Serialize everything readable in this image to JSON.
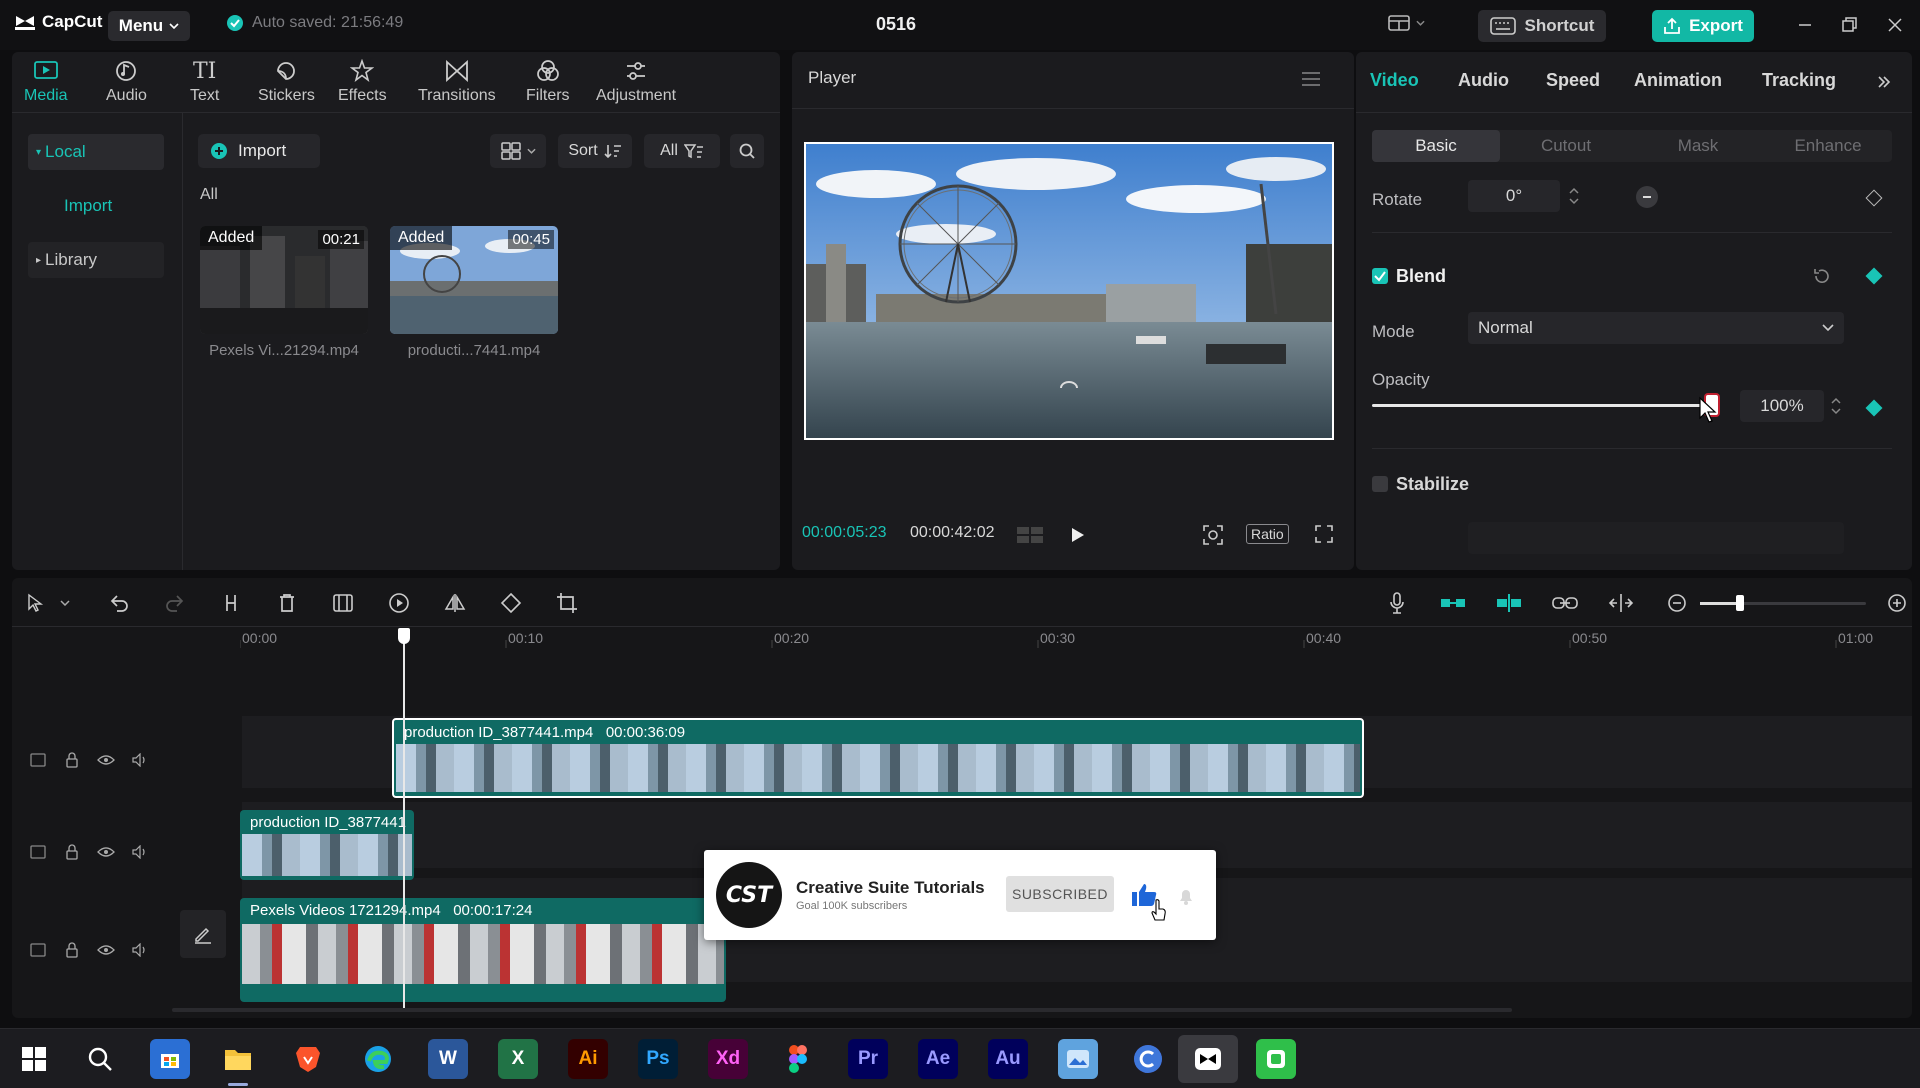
{
  "app": {
    "name": "CapCut",
    "menu_label": "Menu",
    "autosave": "Auto saved: 21:56:49",
    "project_title": "0516",
    "shortcut_label": "Shortcut",
    "export_label": "Export"
  },
  "media_panel": {
    "tabs": [
      {
        "label": "Media",
        "icon": "media-icon",
        "active": true
      },
      {
        "label": "Audio",
        "icon": "audio-icon"
      },
      {
        "label": "Text",
        "icon": "text-icon"
      },
      {
        "label": "Stickers",
        "icon": "stickers-icon"
      },
      {
        "label": "Effects",
        "icon": "effects-icon"
      },
      {
        "label": "Transitions",
        "icon": "transitions-icon"
      },
      {
        "label": "Filters",
        "icon": "filters-icon"
      },
      {
        "label": "Adjustment",
        "icon": "adjustment-icon"
      }
    ],
    "sidebar": {
      "local": "Local",
      "import": "Import",
      "library": "Library"
    },
    "import_label": "Import",
    "sort_label": "Sort",
    "filter_label": "All",
    "section_label": "All",
    "items": [
      {
        "badge": "Added",
        "duration": "00:21",
        "name": "Pexels Vi...21294.mp4"
      },
      {
        "badge": "Added",
        "duration": "00:45",
        "name": "producti...7441.mp4"
      }
    ]
  },
  "player": {
    "title": "Player",
    "current_time": "00:00:05:23",
    "total_time": "00:00:42:02",
    "ratio_label": "Ratio"
  },
  "properties": {
    "tabs": [
      "Video",
      "Audio",
      "Speed",
      "Animation",
      "Tracking"
    ],
    "active_tab": "Video",
    "subtabs": [
      "Basic",
      "Cutout",
      "Mask",
      "Enhance"
    ],
    "active_subtab": "Basic",
    "rotate_label": "Rotate",
    "rotate_value": "0°",
    "blend_label": "Blend",
    "blend_enabled": true,
    "mode_label": "Mode",
    "mode_value": "Normal",
    "opacity_label": "Opacity",
    "opacity_value": "100%",
    "opacity_level": 1.0,
    "stabilize_label": "Stabilize",
    "stabilize_enabled": false,
    "accent": "#19c4b6"
  },
  "timeline": {
    "ruler": [
      "00:00",
      "00:10",
      "00:20",
      "00:30",
      "00:40",
      "00:50",
      "01:00"
    ],
    "clips": [
      {
        "name": "production ID_3877441.mp4",
        "duration": "00:00:36:09"
      },
      {
        "name": "production ID_3877441",
        "duration": ""
      },
      {
        "name": "Pexels Videos 1721294.mp4",
        "duration": "00:00:17:24"
      }
    ]
  },
  "overlay": {
    "logo_text": "CST",
    "channel": "Creative Suite Tutorials",
    "goal": "Goal 100K subscribers",
    "subscribed_label": "SUBSCRIBED"
  },
  "taskbar": {
    "apps": [
      "windows-start",
      "search",
      "store",
      "file-explorer",
      "brave",
      "edge",
      "Word",
      "Excel",
      "Ai",
      "Ps",
      "Xd",
      "Figma",
      "Pr",
      "Ae",
      "Au",
      "Photos",
      "Canva",
      "CapCut",
      "WeChat"
    ]
  }
}
